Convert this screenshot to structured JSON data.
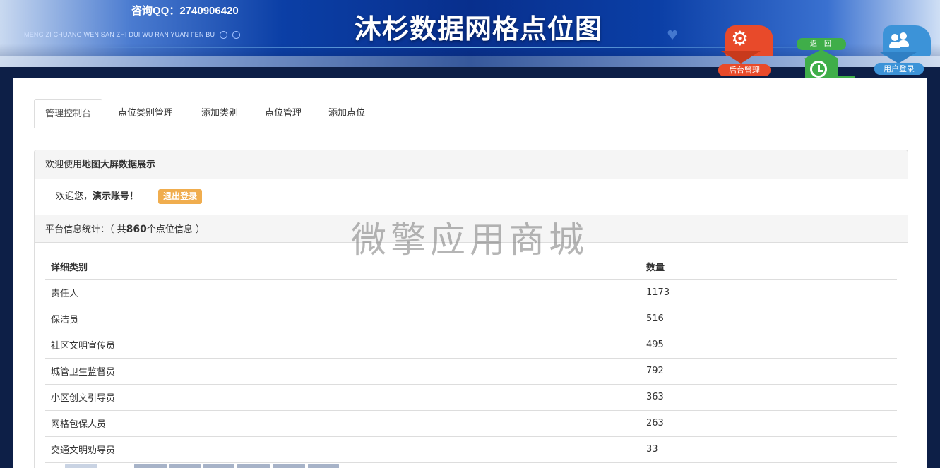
{
  "header": {
    "qq": "咨询QQ：2740906420",
    "pinyin": "MENG ZI CHUANG WEN SAN ZHI DUI  WU RAN YUAN FEN BU",
    "title": "沐杉数据网格点位图"
  },
  "actions": {
    "admin_label": "后台管理",
    "back_label": "返回",
    "user_label": "用户登录"
  },
  "tabs": [
    {
      "label": "管理控制台",
      "active": true
    },
    {
      "label": "点位类别管理",
      "active": false
    },
    {
      "label": "添加类别",
      "active": false
    },
    {
      "label": "点位管理",
      "active": false
    },
    {
      "label": "添加点位",
      "active": false
    }
  ],
  "panel": {
    "head_prefix": "欢迎使用",
    "head_bold": "地图大屏数据展示",
    "welcome_prefix": "欢迎您，",
    "welcome_user": "演示账号！",
    "logout_label": "退出登录",
    "stats_prefix": "平台信息统计：（ 共",
    "stats_count": "860",
    "stats_suffix": "个点位信息 ）"
  },
  "table": {
    "headers": [
      "详细类别",
      "数量"
    ],
    "rows": [
      [
        "责任人",
        "1173"
      ],
      [
        "保洁员",
        "516"
      ],
      [
        "社区文明宣传员",
        "495"
      ],
      [
        "城管卫生监督员",
        "792"
      ],
      [
        "小区创文引导员",
        "363"
      ],
      [
        "网格包保人员",
        "263"
      ],
      [
        "交通文明劝导员",
        "33"
      ]
    ]
  },
  "watermark": "微擎应用商城"
}
